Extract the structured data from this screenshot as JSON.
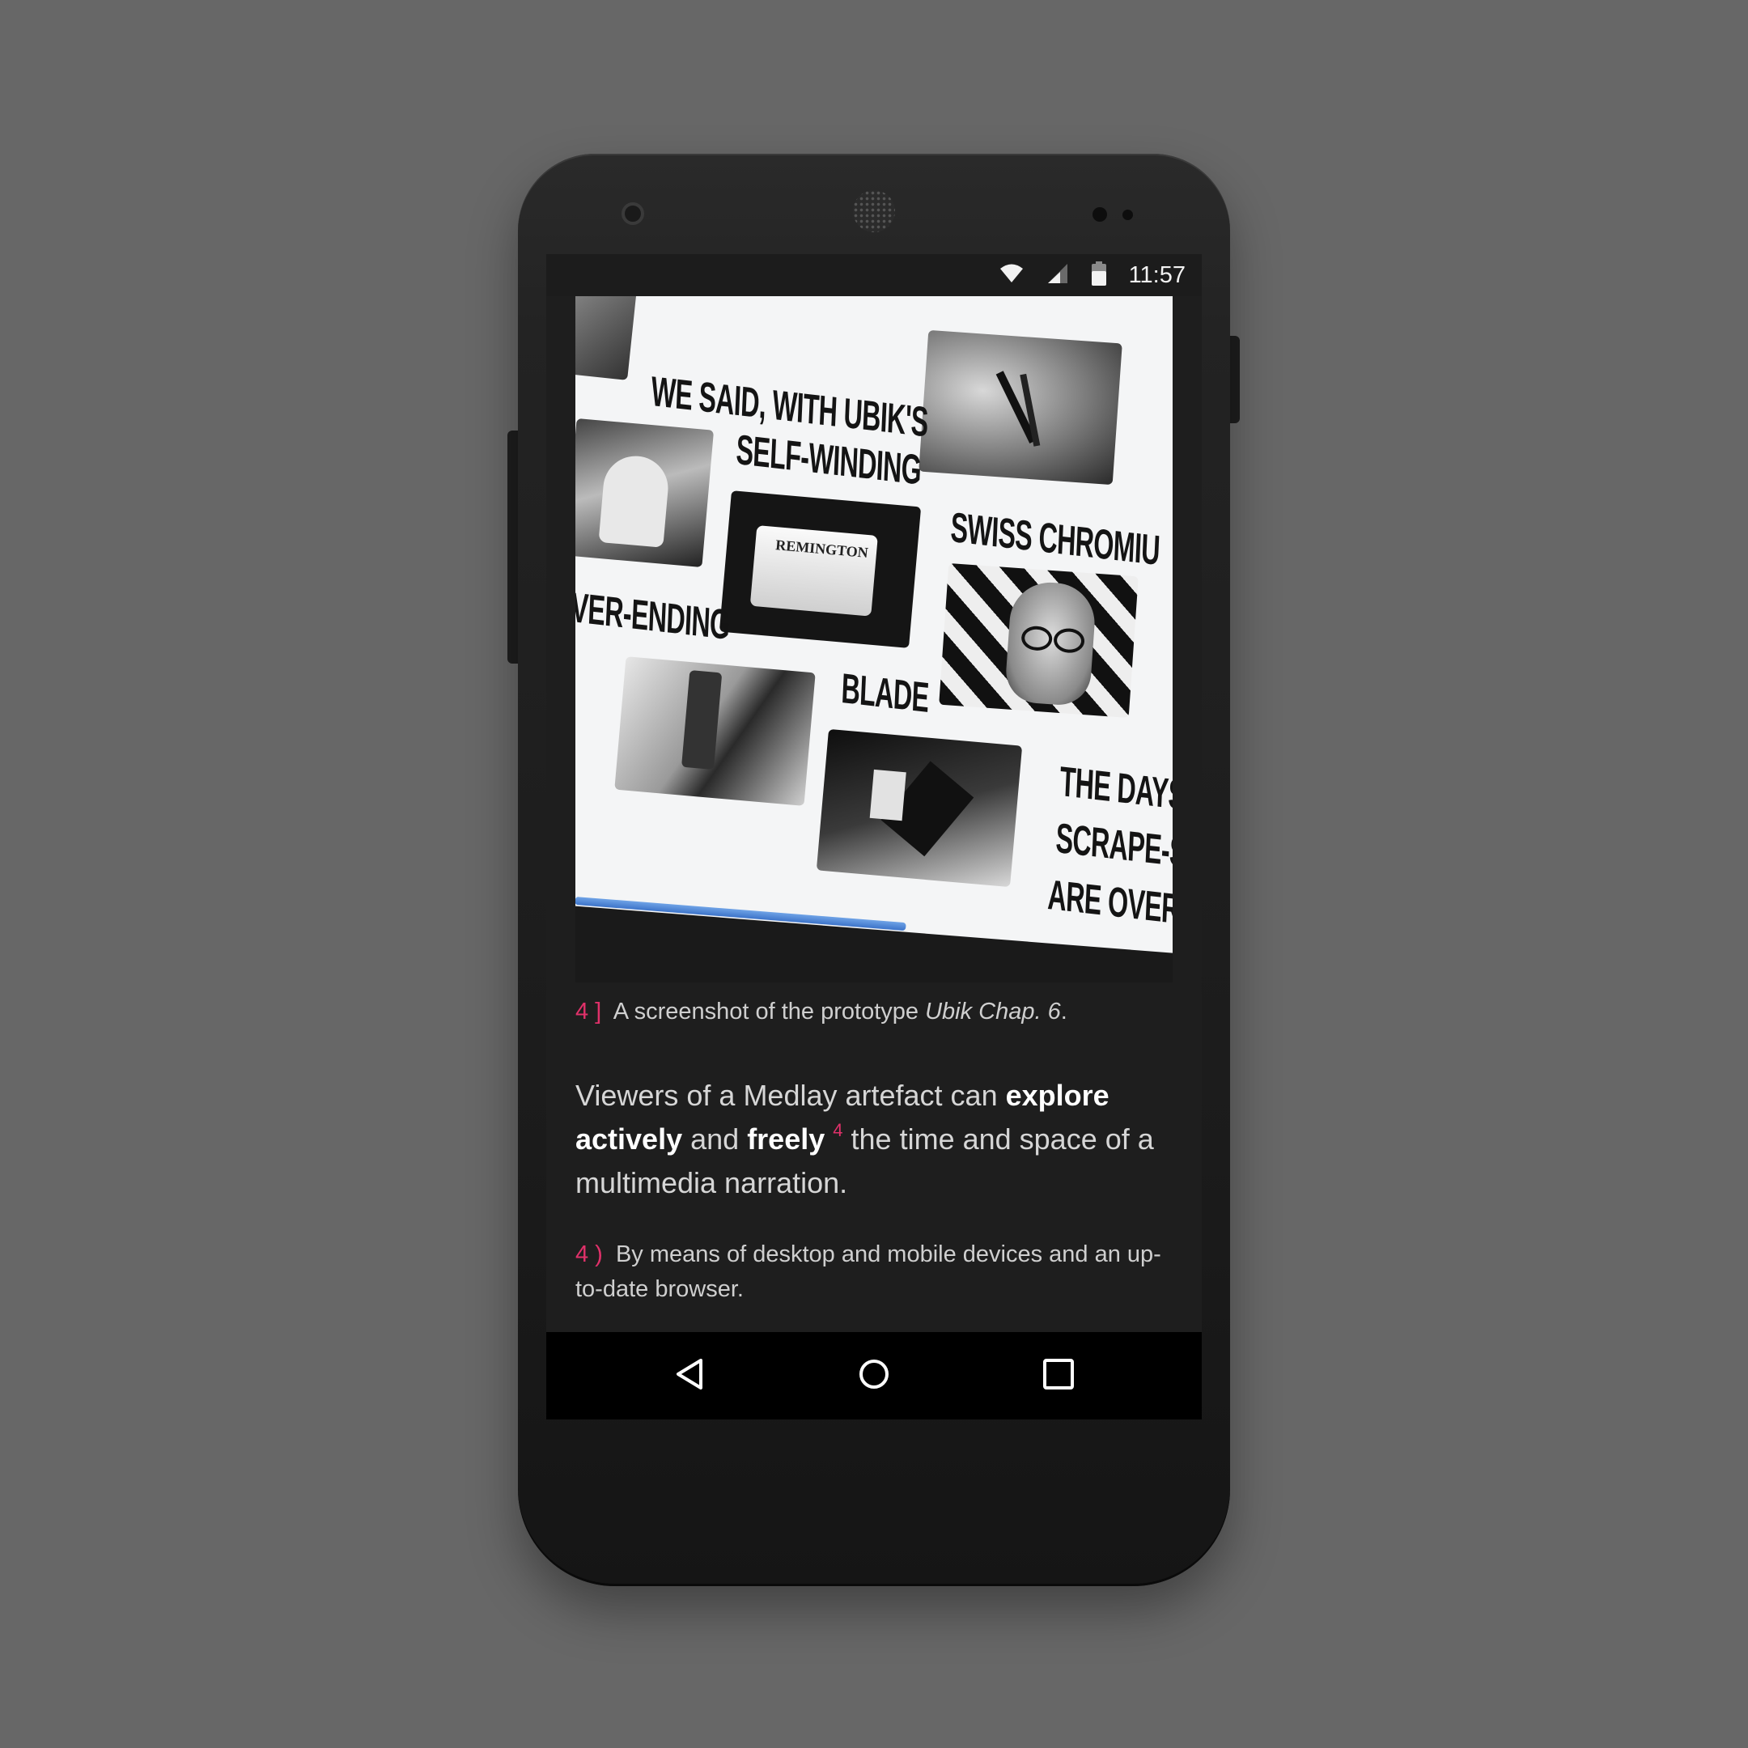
{
  "status_bar": {
    "time": "11:57",
    "icons": [
      "wifi-icon",
      "cellular-signal-icon",
      "battery-icon"
    ]
  },
  "figure": {
    "poster_text": {
      "line1": "WE SAID, WITH UBIK'S",
      "line2": "SELF-WINDING",
      "line3": "SWISS CHROMIU",
      "line4": "VER-ENDING",
      "line5": "BLADE",
      "line6": "THE DAYS",
      "line7": "SCRAPE-S",
      "line8": "ARE OVER.",
      "remington": "REMINGTON"
    }
  },
  "caption": {
    "marker": "4 ]",
    "text_before": "A screenshot of the prototype ",
    "italic": "Ubik Chap. 6",
    "text_after": "."
  },
  "paragraph": {
    "t1": "Viewers of a Medlay artefact can ",
    "b1": "explore",
    "t2": " ",
    "b2": "actively",
    "t3": " and ",
    "b3": "freely",
    "sup": "4",
    "t4": " the time and space of a multimedia narration."
  },
  "footnote": {
    "marker": "4 )",
    "text": "By means of desktop and mobile devices and an up-to-date browser."
  },
  "nav_bar": {
    "buttons": [
      "back-icon",
      "home-icon",
      "recents-icon"
    ]
  },
  "colors": {
    "background": "#676767",
    "accent": "#e0316a",
    "screen": "#1e1e1e"
  }
}
